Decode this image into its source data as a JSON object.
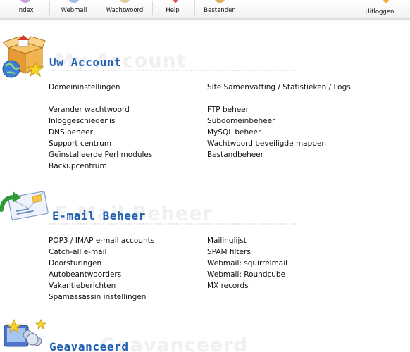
{
  "toolbar": {
    "items": [
      {
        "label": "Index",
        "icon": "home-icon"
      },
      {
        "label": "Webmail",
        "icon": "mail-icon"
      },
      {
        "label": "Wachtwoord",
        "icon": "key-icon"
      },
      {
        "label": "Help",
        "icon": "help-icon"
      },
      {
        "label": "Bestanden",
        "icon": "folder-icon"
      }
    ],
    "logout": {
      "label": "Uitloggen",
      "icon": "logout-icon"
    }
  },
  "sections": [
    {
      "title": "Uw Account",
      "ghost": "My Account",
      "icon": "account-box-globe-star-icon",
      "left": [
        "Domeininstellingen",
        "Verander wachtwoord",
        "Inloggeschiedenis",
        "DNS beheer",
        "Support centrum",
        "Geïnstalleerde Perl modules",
        "Backupcentrum"
      ],
      "right": [
        "Site Samenvatting / Statistieken / Logs",
        "FTP beheer",
        "Subdomeinbeheer",
        "MySQL beheer",
        "Wachtwoord beveiligde mappen",
        "Bestandbeheer"
      ]
    },
    {
      "title": "E-mail Beheer",
      "ghost": "E-Mail Beheer",
      "icon": "email-envelope-arrow-icon",
      "left": [
        "POP3 / IMAP e-mail accounts",
        "Catch-all e-mail",
        "Doorsturingen",
        "Autobeantwoorders",
        "Vakantieberichten",
        "Spamassassin instellingen"
      ],
      "right": [
        "Mailinglijst",
        "SPAM filters",
        "Webmail: squirrelmail",
        "Webmail: Roundcube",
        "MX records"
      ]
    },
    {
      "title": "Geavanceerd",
      "ghost": "Geavanceerd",
      "icon": "advanced-tools-icon"
    }
  ],
  "colors": {
    "title": "#1f5fb2",
    "ghost": "#f0f0f0",
    "text": "#111111"
  }
}
